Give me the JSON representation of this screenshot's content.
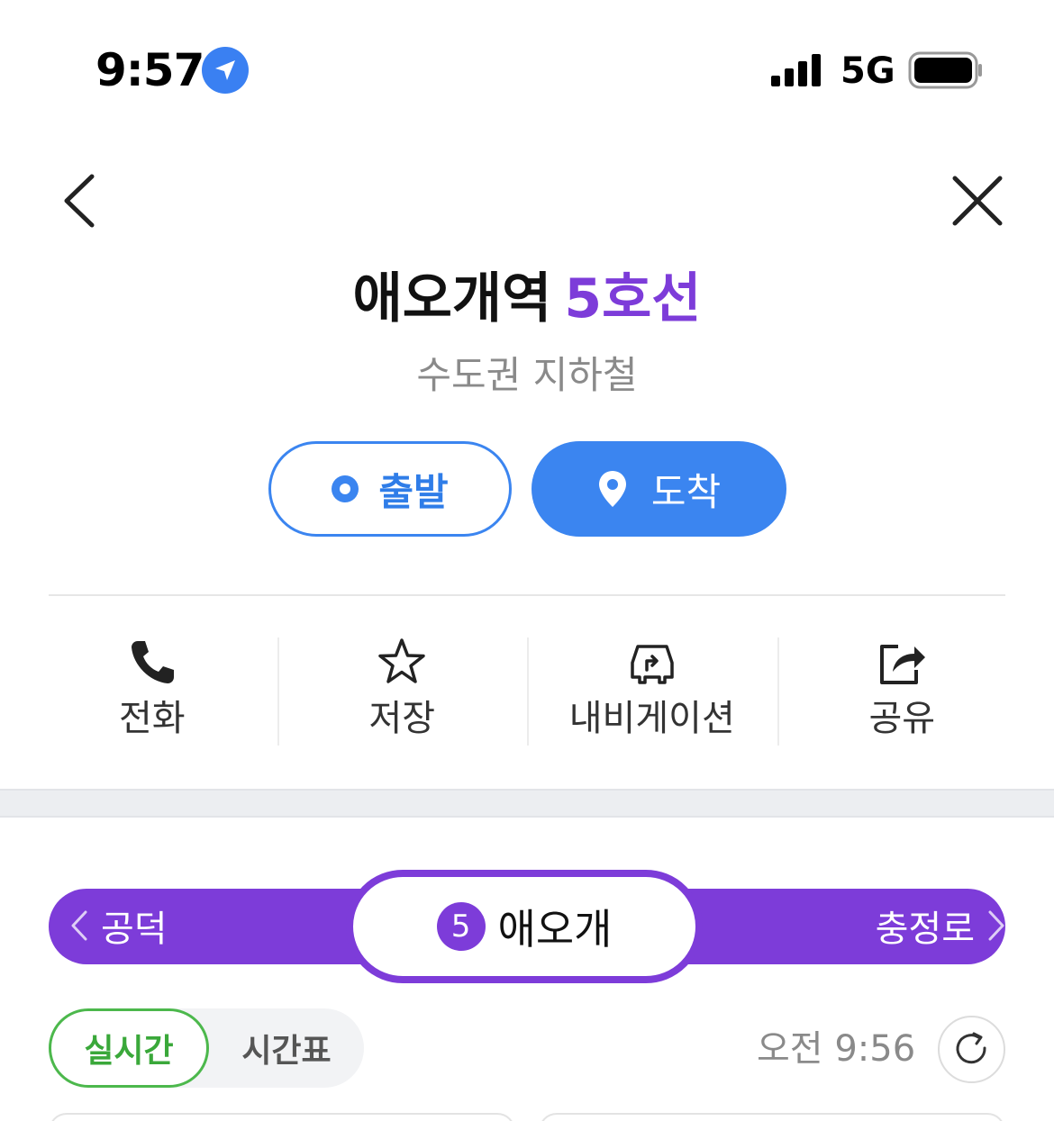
{
  "status_bar": {
    "time": "9:57",
    "network": "5G",
    "location_icon": "location-arrow-icon"
  },
  "header": {
    "back_icon": "chevron-left-icon",
    "close_icon": "close-icon"
  },
  "station": {
    "name": "애오개역",
    "line": "5호선",
    "category": "수도권 지하철"
  },
  "route_buttons": {
    "depart": "출발",
    "arrive": "도착"
  },
  "actions": [
    {
      "label": "전화",
      "icon": "phone-icon"
    },
    {
      "label": "저장",
      "icon": "star-icon"
    },
    {
      "label": "내비게이션",
      "icon": "car-navigation-icon"
    },
    {
      "label": "공유",
      "icon": "share-icon"
    }
  ],
  "line_bar": {
    "prev": "공덕",
    "current": "애오개",
    "line_number": "5",
    "next": "충정로",
    "color": "#7d3cd9"
  },
  "tabs": {
    "realtime": "실시간",
    "timetable": "시간표",
    "active": "실시간"
  },
  "updated_at": "오전 9:56",
  "colors": {
    "accent_blue": "#3b85f0",
    "line5_purple": "#7d3cd9",
    "realtime_green": "#4cb84c"
  }
}
